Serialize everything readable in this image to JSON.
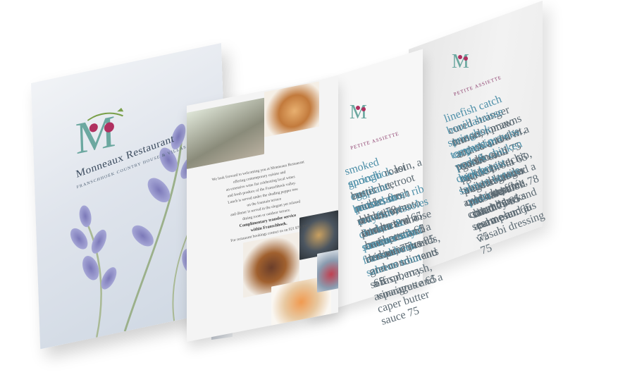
{
  "cover": {
    "title": "Monneaux Restaurant",
    "subtitle": "FRANSCHHOEK COUNTRY HOUSE & VILLAS"
  },
  "intro": {
    "p1": "We look forward to welcoming you at Monneaux Restaurant",
    "p2": "offering contemporary cuisine and",
    "p3": "an extensive wine list celebrating local wines",
    "p4": "and fresh produce of the Franschhoek valley.",
    "p5": "Lunch is served under the shading pepper tree",
    "p6": "on the fountain terrace",
    "p7": "and dinner is served in the elegant yet relaxed",
    "p8": "dining room or outdoor terrace.",
    "strong1": "Complimentary transfer service",
    "strong2": "within Franschhoek.",
    "p9": "For restaurant bookings contact us on 021 876 3386"
  },
  "middle_menu": {
    "heading": "PETITE ASSIETTE",
    "items": [
      {
        "dish": "smoked springbok",
        "text": "loin, a rustic beetroot pickle, fresh herbs 78"
      },
      {
        "dish": "gnocchi",
        "text": "roast butternut, mushroom, olives, tomato and brown 65"
      },
      {
        "dish": "eggplant parmesan",
        "text": "panenhouse tomato and a basil pesto 65"
      },
      {
        "dish": "braised short rib",
        "text": "red wine, pommes croquette and a red wine jus 85"
      },
      {
        "dish": "crayfish rissoles",
        "text": "lime, a brunoise and a seafood bisque 75"
      },
      {
        "dish": "chicken & prawn curry",
        "text": "aromatic rice and condiments 65"
      },
      {
        "dish": "summer salad",
        "text": "berries, almonds, greens sour and a raspberry vinaigrette 65"
      },
      {
        "dish": "franschhoek salmon trout",
        "text": "saffron, mash, asparagus and a caper butter sauce 75"
      }
    ]
  },
  "right_menu": {
    "heading": "PETITE ASSIETTE",
    "items": [
      {
        "dish": "linefish catch",
        "text": "cured stranger lemon, tomato crumb and a garlic aioli 75"
      },
      {
        "dish": "bouillabaisse",
        "text": "mussels, prawns and calamari in a tomato and garlic broth 65"
      },
      {
        "dish": "springbok carpaccio",
        "text": "rocket, pecorino, pickled vegetables and a mustard aioli 78"
      },
      {
        "dish": "tempura prawns",
        "text": "wasabi mayonnaise, pickled ginger and a sesame salad 75"
      },
      {
        "dish": "pork & chicken terrine",
        "text": "pistachio, cherries and a red onion chutney 65"
      },
      {
        "dish": "duck breast",
        "text": "braised lentils, celeriac purée, charred leeks and a plum jus 75"
      },
      {
        "dish": "salmon tartare",
        "text": "avocado, cucumber, sesame and a wasabi dressing 75"
      },
      {
        "dish": "pasta",
        "text": "truffle mushroom and parmesan 65"
      }
    ]
  }
}
